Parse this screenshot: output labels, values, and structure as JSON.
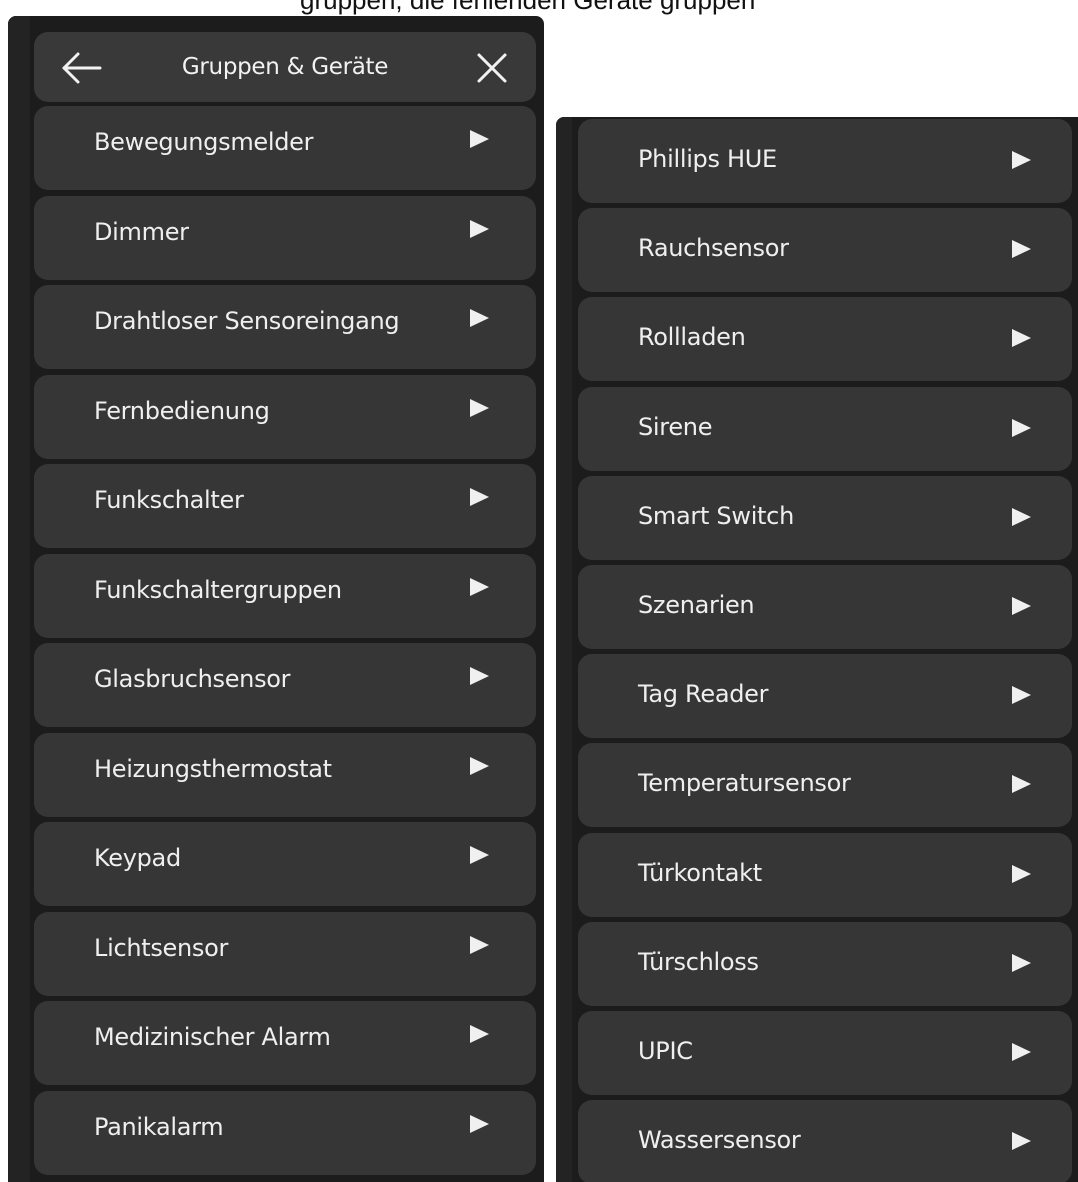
{
  "top_fragment": "gruppen, die fehlenden Geräte gruppen",
  "header": {
    "title": "Gruppen & Geräte",
    "back_icon": "arrow-left-icon",
    "close_icon": "close-icon"
  },
  "left_items": [
    "Bewegungsmelder",
    "Dimmer",
    "Drahtloser Sensoreingang",
    "Fernbedienung",
    "Funkschalter",
    "Funkschaltergruppen",
    "Glasbruchsensor",
    "Heizungsthermostat",
    "Keypad",
    "Lichtsensor",
    "Medizinischer Alarm",
    "Panikalarm"
  ],
  "right_items": [
    "Phillips HUE",
    "Rauchsensor",
    "Rollladen",
    "Sirene",
    "Smart Switch",
    "Szenarien",
    "Tag Reader",
    "Temperatursensor",
    "Türkontakt",
    "Türschloss",
    "UPIC",
    "Wassersensor"
  ],
  "item_icon": "play-arrow-icon",
  "colors": {
    "panel_bg": "#1c1c1c",
    "item_bg": "#363636",
    "header_bg": "#393939",
    "text": "#efefef"
  }
}
